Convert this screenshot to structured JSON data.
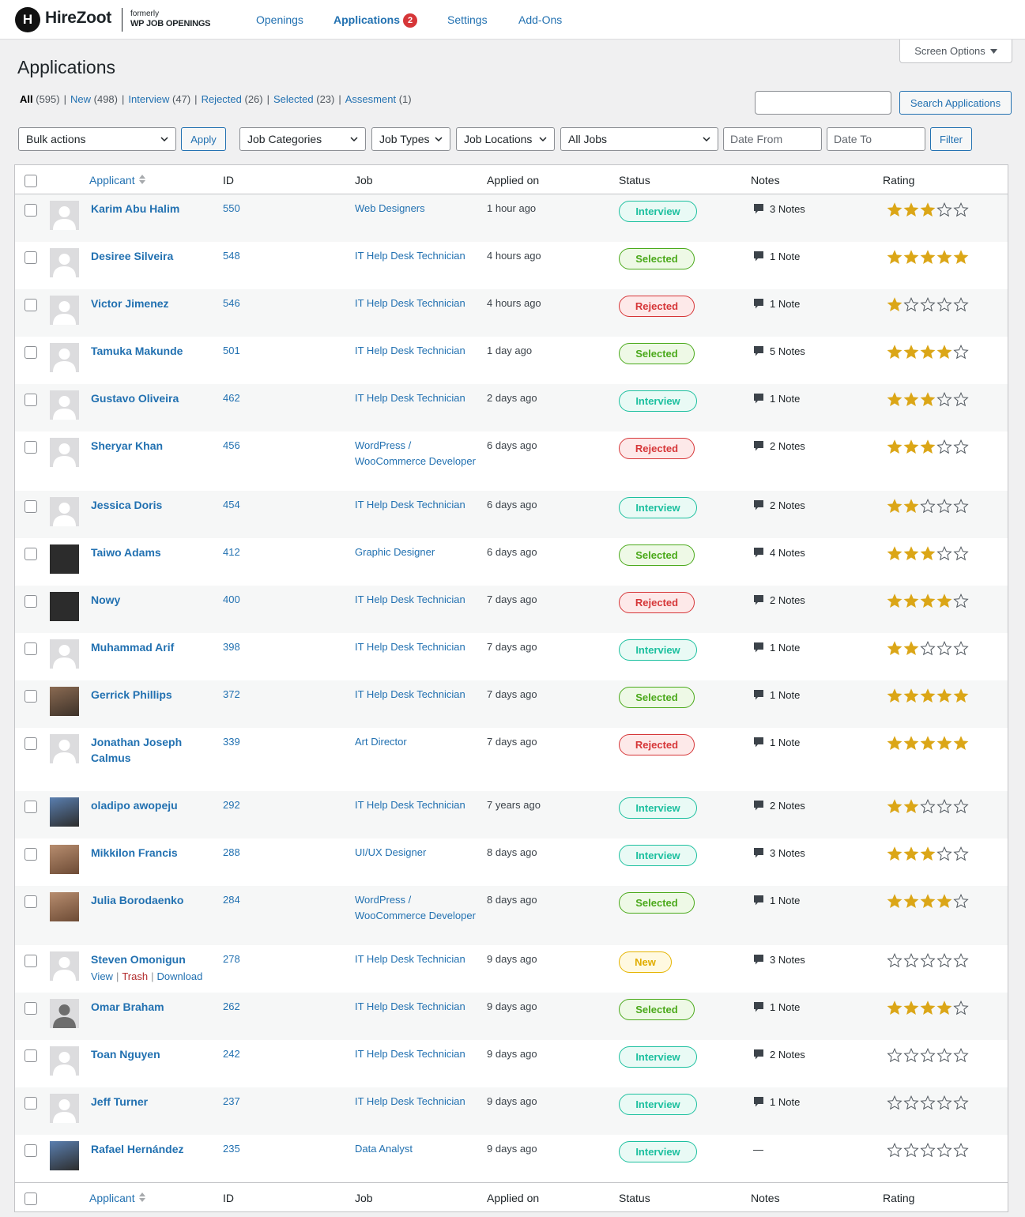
{
  "brand": {
    "logo_letter": "H",
    "name": "HireZoot",
    "formerly": "formerly",
    "former_name": "WP JOB OPENINGS"
  },
  "nav": {
    "openings": "Openings",
    "applications": "Applications",
    "applications_badge": "2",
    "settings": "Settings",
    "addons": "Add-Ons"
  },
  "screen_options": "Screen Options",
  "page_title": "Applications",
  "filters_status": [
    {
      "label": "All",
      "count": "(595)"
    },
    {
      "label": "New",
      "count": "(498)"
    },
    {
      "label": "Interview",
      "count": "(47)"
    },
    {
      "label": "Rejected",
      "count": "(26)"
    },
    {
      "label": "Selected",
      "count": "(23)"
    },
    {
      "label": "Assesment",
      "count": "(1)"
    }
  ],
  "search": {
    "button": "Search Applications",
    "value": ""
  },
  "toolbar": {
    "bulk": "Bulk actions",
    "apply": "Apply",
    "job_categories": "Job Categories",
    "job_types": "Job Types",
    "job_locations": "Job Locations",
    "all_jobs": "All Jobs",
    "date_from": "Date From",
    "date_to": "Date To",
    "filter": "Filter"
  },
  "columns": {
    "applicant": "Applicant",
    "id": "ID",
    "job": "Job",
    "applied_on": "Applied on",
    "status": "Status",
    "notes": "Notes",
    "rating": "Rating"
  },
  "row_actions": {
    "view": "View",
    "trash": "Trash",
    "download": "Download"
  },
  "colors": {
    "accent": "#2271b1",
    "star": "#dba617",
    "interview": "#1cc09f",
    "selected": "#4aa91a",
    "rejected": "#d63638",
    "new": "#e0ad00"
  },
  "rows": [
    {
      "name": "Karim Abu Halim",
      "id": "550",
      "job": "Web Designers",
      "applied": "1 hour ago",
      "status": "Interview",
      "notes": "3 Notes",
      "rating": 3
    },
    {
      "name": "Desiree Silveira",
      "id": "548",
      "job": "IT Help Desk Technician",
      "applied": "4 hours ago",
      "status": "Selected",
      "notes": "1 Note",
      "rating": 5
    },
    {
      "name": "Victor Jimenez",
      "id": "546",
      "job": "IT Help Desk Technician",
      "applied": "4 hours ago",
      "status": "Rejected",
      "notes": "1 Note",
      "rating": 1
    },
    {
      "name": "Tamuka Makunde",
      "id": "501",
      "job": "IT Help Desk Technician",
      "applied": "1 day ago",
      "status": "Selected",
      "notes": "5 Notes",
      "rating": 4
    },
    {
      "name": "Gustavo Oliveira",
      "id": "462",
      "job": "IT Help Desk Technician",
      "applied": "2 days ago",
      "status": "Interview",
      "notes": "1 Note",
      "rating": 3
    },
    {
      "name": "Sheryar Khan",
      "id": "456",
      "job": "WordPress / WooCommerce Developer",
      "applied": "6 days ago",
      "status": "Rejected",
      "notes": "2 Notes",
      "rating": 3
    },
    {
      "name": "Jessica Doris",
      "id": "454",
      "job": "IT Help Desk Technician",
      "applied": "6 days ago",
      "status": "Interview",
      "notes": "2 Notes",
      "rating": 2
    },
    {
      "name": "Taiwo Adams",
      "id": "412",
      "job": "Graphic Designer",
      "applied": "6 days ago",
      "status": "Selected",
      "notes": "4 Notes",
      "rating": 3
    },
    {
      "name": "Nowy",
      "id": "400",
      "job": "IT Help Desk Technician",
      "applied": "7 days ago",
      "status": "Rejected",
      "notes": "2 Notes",
      "rating": 4
    },
    {
      "name": "Muhammad Arif",
      "id": "398",
      "job": "IT Help Desk Technician",
      "applied": "7 days ago",
      "status": "Interview",
      "notes": "1 Note",
      "rating": 2
    },
    {
      "name": "Gerrick Phillips",
      "id": "372",
      "job": "IT Help Desk Technician",
      "applied": "7 days ago",
      "status": "Selected",
      "notes": "1 Note",
      "rating": 5
    },
    {
      "name": "Jonathan Joseph Calmus",
      "id": "339",
      "job": "Art Director",
      "applied": "7 days ago",
      "status": "Rejected",
      "notes": "1 Note",
      "rating": 5
    },
    {
      "name": "oladipo awopeju",
      "id": "292",
      "job": "IT Help Desk Technician",
      "applied": "7 years ago",
      "status": "Interview",
      "notes": "2 Notes",
      "rating": 2
    },
    {
      "name": "Mikkilon Francis",
      "id": "288",
      "job": "UI/UX Designer",
      "applied": "8 days ago",
      "status": "Interview",
      "notes": "3 Notes",
      "rating": 3
    },
    {
      "name": "Julia Borodaenko",
      "id": "284",
      "job": "WordPress / WooCommerce Developer",
      "applied": "8 days ago",
      "status": "Selected",
      "notes": "1 Note",
      "rating": 4
    },
    {
      "name": "Steven Omonigun",
      "id": "278",
      "job": "IT Help Desk Technician",
      "applied": "9 days ago",
      "status": "New",
      "notes": "3 Notes",
      "rating": 0
    },
    {
      "name": "Omar Braham",
      "id": "262",
      "job": "IT Help Desk Technician",
      "applied": "9 days ago",
      "status": "Selected",
      "notes": "1 Note",
      "rating": 4
    },
    {
      "name": "Toan Nguyen",
      "id": "242",
      "job": "IT Help Desk Technician",
      "applied": "9 days ago",
      "status": "Interview",
      "notes": "2 Notes",
      "rating": 0
    },
    {
      "name": "Jeff Turner",
      "id": "237",
      "job": "IT Help Desk Technician",
      "applied": "9 days ago",
      "status": "Interview",
      "notes": "1 Note",
      "rating": 0
    },
    {
      "name": "Rafael Hernández",
      "id": "235",
      "job": "Data Analyst",
      "applied": "9 days ago",
      "status": "Interview",
      "notes": "—",
      "rating": 0
    }
  ]
}
